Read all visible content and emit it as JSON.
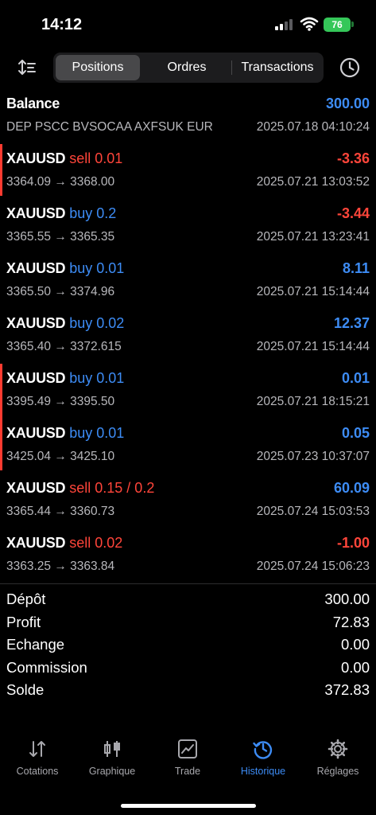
{
  "status_bar": {
    "time": "14:12",
    "battery": "76"
  },
  "toolbar": {
    "tabs": [
      {
        "label": "Positions",
        "active": true
      },
      {
        "label": "Ordres",
        "active": false
      },
      {
        "label": "Transactions",
        "active": false
      }
    ]
  },
  "balance_row": {
    "title": "Balance",
    "amount": "300.00",
    "description": "DEP PSCC BVSOCAA AXFSUK EUR",
    "datetime": "2025.07.18 04:10:24"
  },
  "positions": [
    {
      "symbol": "XAUUSD",
      "side": "sell",
      "volume": "0.01",
      "prices": "3364.09 → 3368.00",
      "profit": "-3.36",
      "datetime": "2025.07.21 13:03:52",
      "marked": true
    },
    {
      "symbol": "XAUUSD",
      "side": "buy",
      "volume": "0.2",
      "prices": "3365.55 → 3365.35",
      "profit": "-3.44",
      "datetime": "2025.07.21 13:23:41",
      "marked": false
    },
    {
      "symbol": "XAUUSD",
      "side": "buy",
      "volume": "0.01",
      "prices": "3365.50 → 3374.96",
      "profit": "8.11",
      "datetime": "2025.07.21 15:14:44",
      "marked": false
    },
    {
      "symbol": "XAUUSD",
      "side": "buy",
      "volume": "0.02",
      "prices": "3365.40 → 3372.615",
      "profit": "12.37",
      "datetime": "2025.07.21 15:14:44",
      "marked": false
    },
    {
      "symbol": "XAUUSD",
      "side": "buy",
      "volume": "0.01",
      "prices": "3395.49 → 3395.50",
      "profit": "0.01",
      "datetime": "2025.07.21 18:15:21",
      "marked": true
    },
    {
      "symbol": "XAUUSD",
      "side": "buy",
      "volume": "0.01",
      "prices": "3425.04 → 3425.10",
      "profit": "0.05",
      "datetime": "2025.07.23 10:37:07",
      "marked": true
    },
    {
      "symbol": "XAUUSD",
      "side": "sell",
      "volume": "0.15 / 0.2",
      "prices": "3365.44 → 3360.73",
      "profit": "60.09",
      "datetime": "2025.07.24 15:03:53",
      "marked": false
    },
    {
      "symbol": "XAUUSD",
      "side": "sell",
      "volume": "0.02",
      "prices": "3363.25 → 3363.84",
      "profit": "-1.00",
      "datetime": "2025.07.24 15:06:23",
      "marked": false
    }
  ],
  "summary": [
    {
      "label": "Dépôt",
      "value": "300.00"
    },
    {
      "label": "Profit",
      "value": "72.83"
    },
    {
      "label": "Echange",
      "value": "0.00"
    },
    {
      "label": "Commission",
      "value": "0.00"
    },
    {
      "label": "Solde",
      "value": "372.83"
    }
  ],
  "tabbar": [
    {
      "label": "Cotations",
      "icon": "arrows-updown-icon",
      "active": false
    },
    {
      "label": "Graphique",
      "icon": "candlestick-icon",
      "active": false
    },
    {
      "label": "Trade",
      "icon": "trend-chart-icon",
      "active": false
    },
    {
      "label": "Historique",
      "icon": "history-clock-icon",
      "active": true
    },
    {
      "label": "Réglages",
      "icon": "gear-icon",
      "active": false
    }
  ],
  "colors": {
    "accent": "#3d8cf5",
    "negative": "#ff453a",
    "battery": "#35c759",
    "marker": "#ff3b30"
  }
}
